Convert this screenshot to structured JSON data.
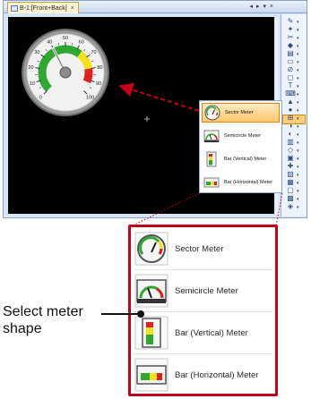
{
  "window": {
    "tab_label": "B-1:[Front+Back]",
    "tab_close": "×",
    "tab_controls": "◂ ▸ ▾ ×"
  },
  "gauge": {
    "value": 40,
    "min": 0,
    "max": 100,
    "ticks": [
      "0",
      "10",
      "20",
      "30",
      "40",
      "50",
      "60",
      "70",
      "80",
      "90",
      "100"
    ],
    "zone_colors": {
      "green": "#2fa82f",
      "yellow": "#f2e21b",
      "red": "#e02020"
    }
  },
  "small_menu": {
    "items": [
      {
        "label": "Sector Meter",
        "icon": "sector-meter-icon"
      },
      {
        "label": "Semicircle Meter",
        "icon": "semicircle-meter-icon"
      },
      {
        "label": "Bar (Vertical) Meter",
        "icon": "bar-vertical-meter-icon"
      },
      {
        "label": "Bar (Horizontal) Meter",
        "icon": "bar-horizontal-meter-icon"
      }
    ],
    "selected": "Sector Meter"
  },
  "big_menu": {
    "items": [
      {
        "label": "Sector Meter",
        "icon": "sector-meter-icon"
      },
      {
        "label": "Semicircle Meter",
        "icon": "semicircle-meter-icon"
      },
      {
        "label": "Bar (Vertical) Meter",
        "icon": "bar-vertical-meter-icon"
      },
      {
        "label": "Bar (Horizontal) Meter",
        "icon": "bar-horizontal-meter-icon"
      }
    ]
  },
  "callout": {
    "text": "Select meter shape"
  },
  "colors": {
    "highlight_border": "#c4001b",
    "selected_fill": "#ffc76a",
    "arrow": "#c4001b"
  }
}
